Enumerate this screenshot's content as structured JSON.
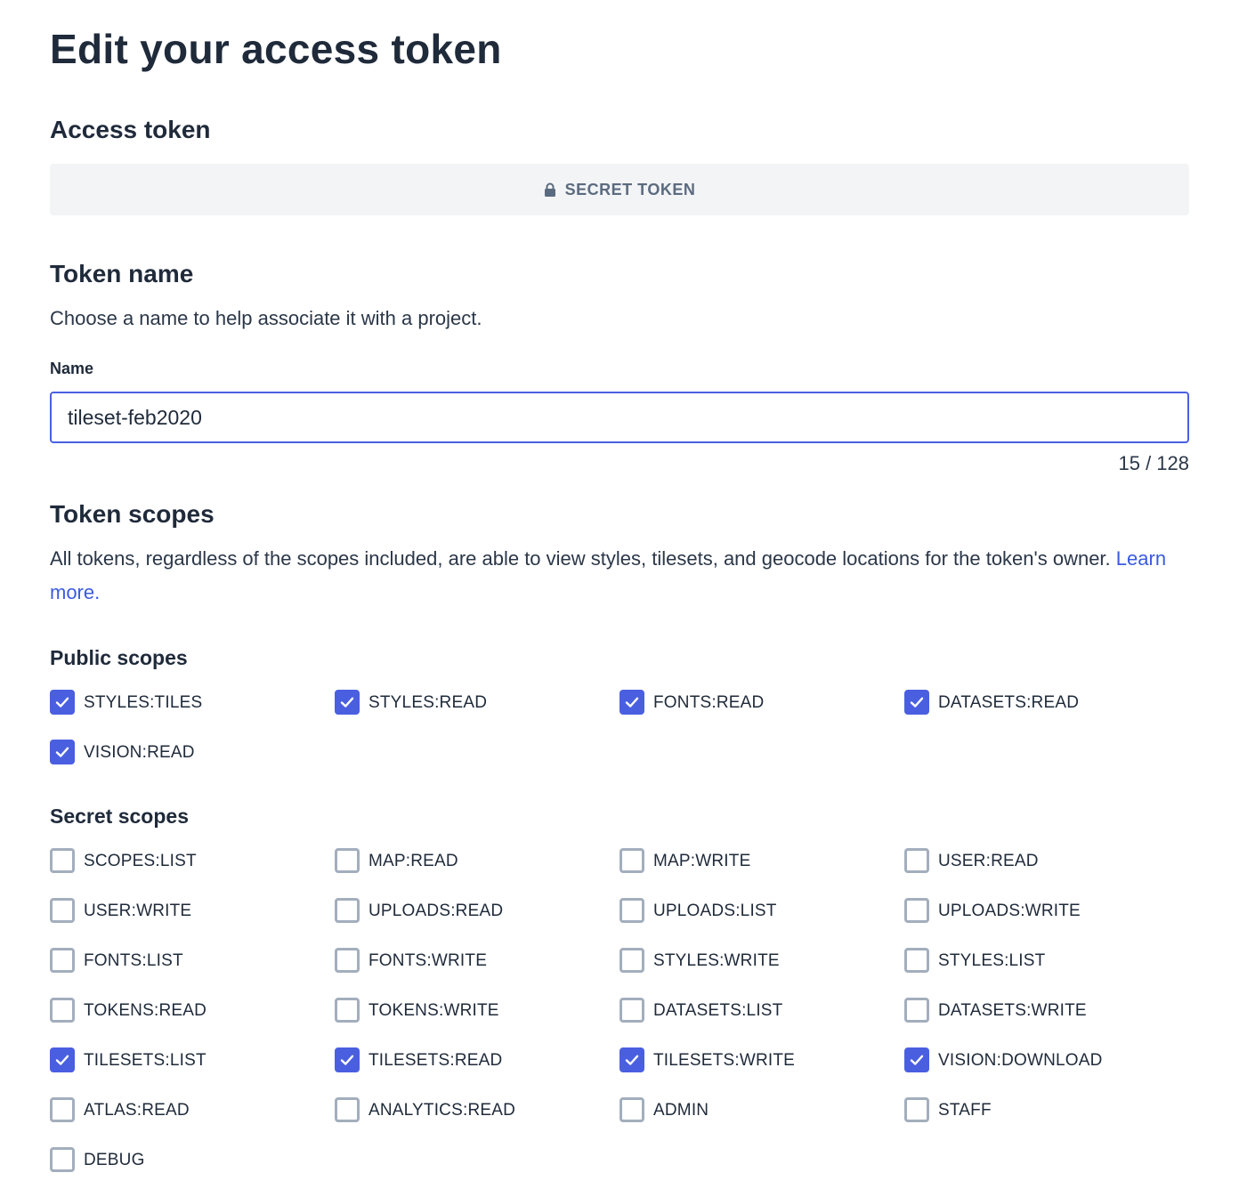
{
  "page": {
    "title": "Edit your access token"
  },
  "access_token": {
    "heading": "Access token",
    "secret_label": "SECRET TOKEN"
  },
  "token_name": {
    "heading": "Token name",
    "description": "Choose a name to help associate it with a project.",
    "field_label": "Name",
    "value": "tileset-feb2020",
    "counter": "15 / 128"
  },
  "token_scopes": {
    "heading": "Token scopes",
    "description": "All tokens, regardless of the scopes included, are able to view styles, tilesets, and geocode locations for the token's owner.",
    "learn_more": "Learn more."
  },
  "public_scopes": {
    "heading": "Public scopes",
    "items": [
      {
        "label": "STYLES:TILES",
        "checked": true
      },
      {
        "label": "STYLES:READ",
        "checked": true
      },
      {
        "label": "FONTS:READ",
        "checked": true
      },
      {
        "label": "DATASETS:READ",
        "checked": true
      },
      {
        "label": "VISION:READ",
        "checked": true
      }
    ]
  },
  "secret_scopes": {
    "heading": "Secret scopes",
    "items": [
      {
        "label": "SCOPES:LIST",
        "checked": false
      },
      {
        "label": "MAP:READ",
        "checked": false
      },
      {
        "label": "MAP:WRITE",
        "checked": false
      },
      {
        "label": "USER:READ",
        "checked": false
      },
      {
        "label": "USER:WRITE",
        "checked": false
      },
      {
        "label": "UPLOADS:READ",
        "checked": false
      },
      {
        "label": "UPLOADS:LIST",
        "checked": false
      },
      {
        "label": "UPLOADS:WRITE",
        "checked": false
      },
      {
        "label": "FONTS:LIST",
        "checked": false
      },
      {
        "label": "FONTS:WRITE",
        "checked": false
      },
      {
        "label": "STYLES:WRITE",
        "checked": false
      },
      {
        "label": "STYLES:LIST",
        "checked": false
      },
      {
        "label": "TOKENS:READ",
        "checked": false
      },
      {
        "label": "TOKENS:WRITE",
        "checked": false
      },
      {
        "label": "DATASETS:LIST",
        "checked": false
      },
      {
        "label": "DATASETS:WRITE",
        "checked": false
      },
      {
        "label": "TILESETS:LIST",
        "checked": true
      },
      {
        "label": "TILESETS:READ",
        "checked": true
      },
      {
        "label": "TILESETS:WRITE",
        "checked": true
      },
      {
        "label": "VISION:DOWNLOAD",
        "checked": true
      },
      {
        "label": "ATLAS:READ",
        "checked": false
      },
      {
        "label": "ANALYTICS:READ",
        "checked": false
      },
      {
        "label": "ADMIN",
        "checked": false
      },
      {
        "label": "STAFF",
        "checked": false
      },
      {
        "label": "DEBUG",
        "checked": false
      }
    ]
  },
  "colors": {
    "accent": "#4a5fe0",
    "link": "#3a5be0",
    "text": "#1f2a3a",
    "checkbox_border": "#a3aebd",
    "token_bar_bg": "#f3f4f6"
  }
}
